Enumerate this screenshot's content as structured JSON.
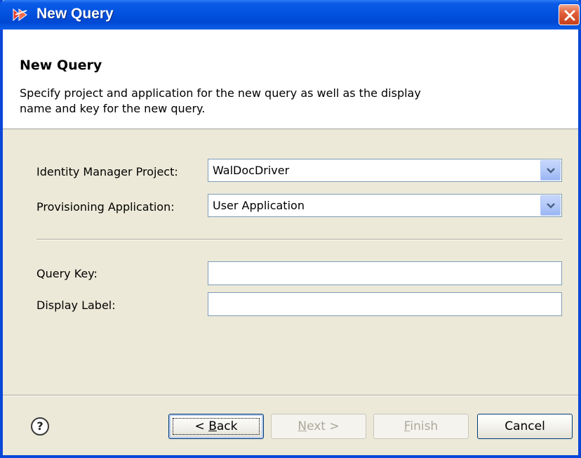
{
  "window": {
    "title": "New Query",
    "close_icon": "close-icon",
    "colors": {
      "titlebar": "#0252E0",
      "frame": "#0A46D8",
      "body": "#ECE9D8",
      "close": "#E25F3B"
    }
  },
  "header": {
    "title": "New Query",
    "description_line1": "Specify project and application for the new query as well as the display",
    "description_line2": "name and key for the new query."
  },
  "form": {
    "project_label": "Identity Manager Project:",
    "project_value": "WalDocDriver",
    "application_label": "Provisioning Application:",
    "application_value": "User Application",
    "query_key_label": "Query Key:",
    "query_key_value": "",
    "display_label_label": "Display Label:",
    "display_label_value": ""
  },
  "buttons": {
    "back_prefix": "< ",
    "back_mnemonic": "B",
    "back_rest": "ack",
    "next_mnemonic": "N",
    "next_rest": "ext >",
    "finish_mnemonic": "F",
    "finish_rest": "inish",
    "cancel": "Cancel",
    "help_icon": "help-icon"
  }
}
